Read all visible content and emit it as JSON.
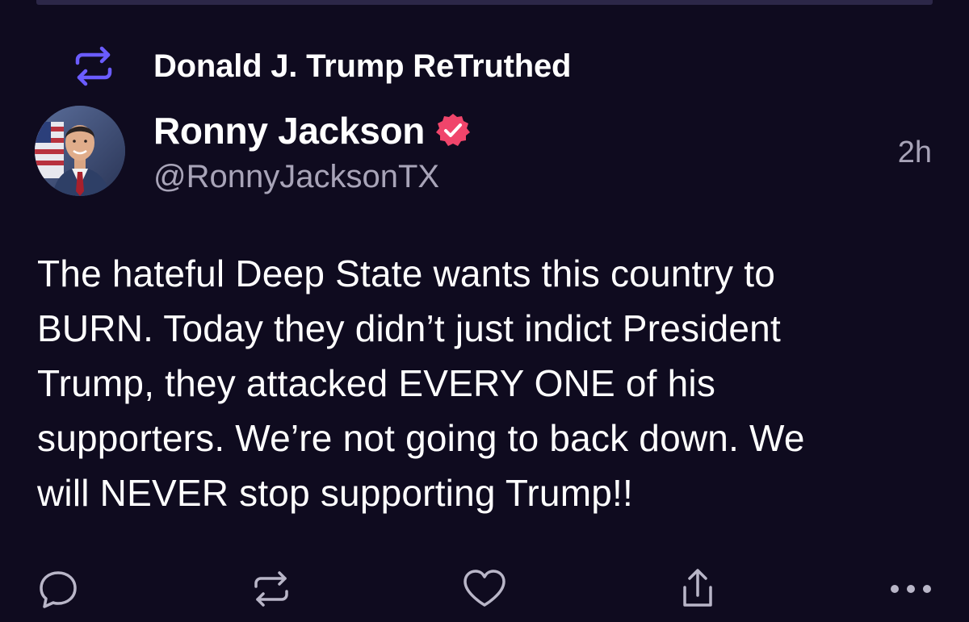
{
  "retruth": {
    "label": "Donald J. Trump ReTruthed",
    "icon": "retruth-icon"
  },
  "author": {
    "name": "Ronny Jackson",
    "handle": "@RonnyJacksonTX",
    "verified": true,
    "verified_icon": "verified-badge-icon",
    "avatar": "avatar"
  },
  "timestamp": "2h",
  "post": {
    "text": "The hateful Deep State wants this country to\nBURN. Today they didn’t just indict President\nTrump, they attacked EVERY ONE of his\nsupporters. We’re not going to back down. We\nwill NEVER stop supporting Trump!!"
  },
  "actions": [
    {
      "name": "reply",
      "icon": "comment-icon"
    },
    {
      "name": "retruth",
      "icon": "retruth-icon"
    },
    {
      "name": "like",
      "icon": "heart-icon"
    },
    {
      "name": "share",
      "icon": "share-icon"
    },
    {
      "name": "more",
      "icon": "more-icon"
    }
  ],
  "colors": {
    "background": "#0f0b1f",
    "accent": "#6b5cff",
    "verified": "#f0456b",
    "muted_text": "#a8a4b8",
    "icon": "#b9b6c8"
  }
}
